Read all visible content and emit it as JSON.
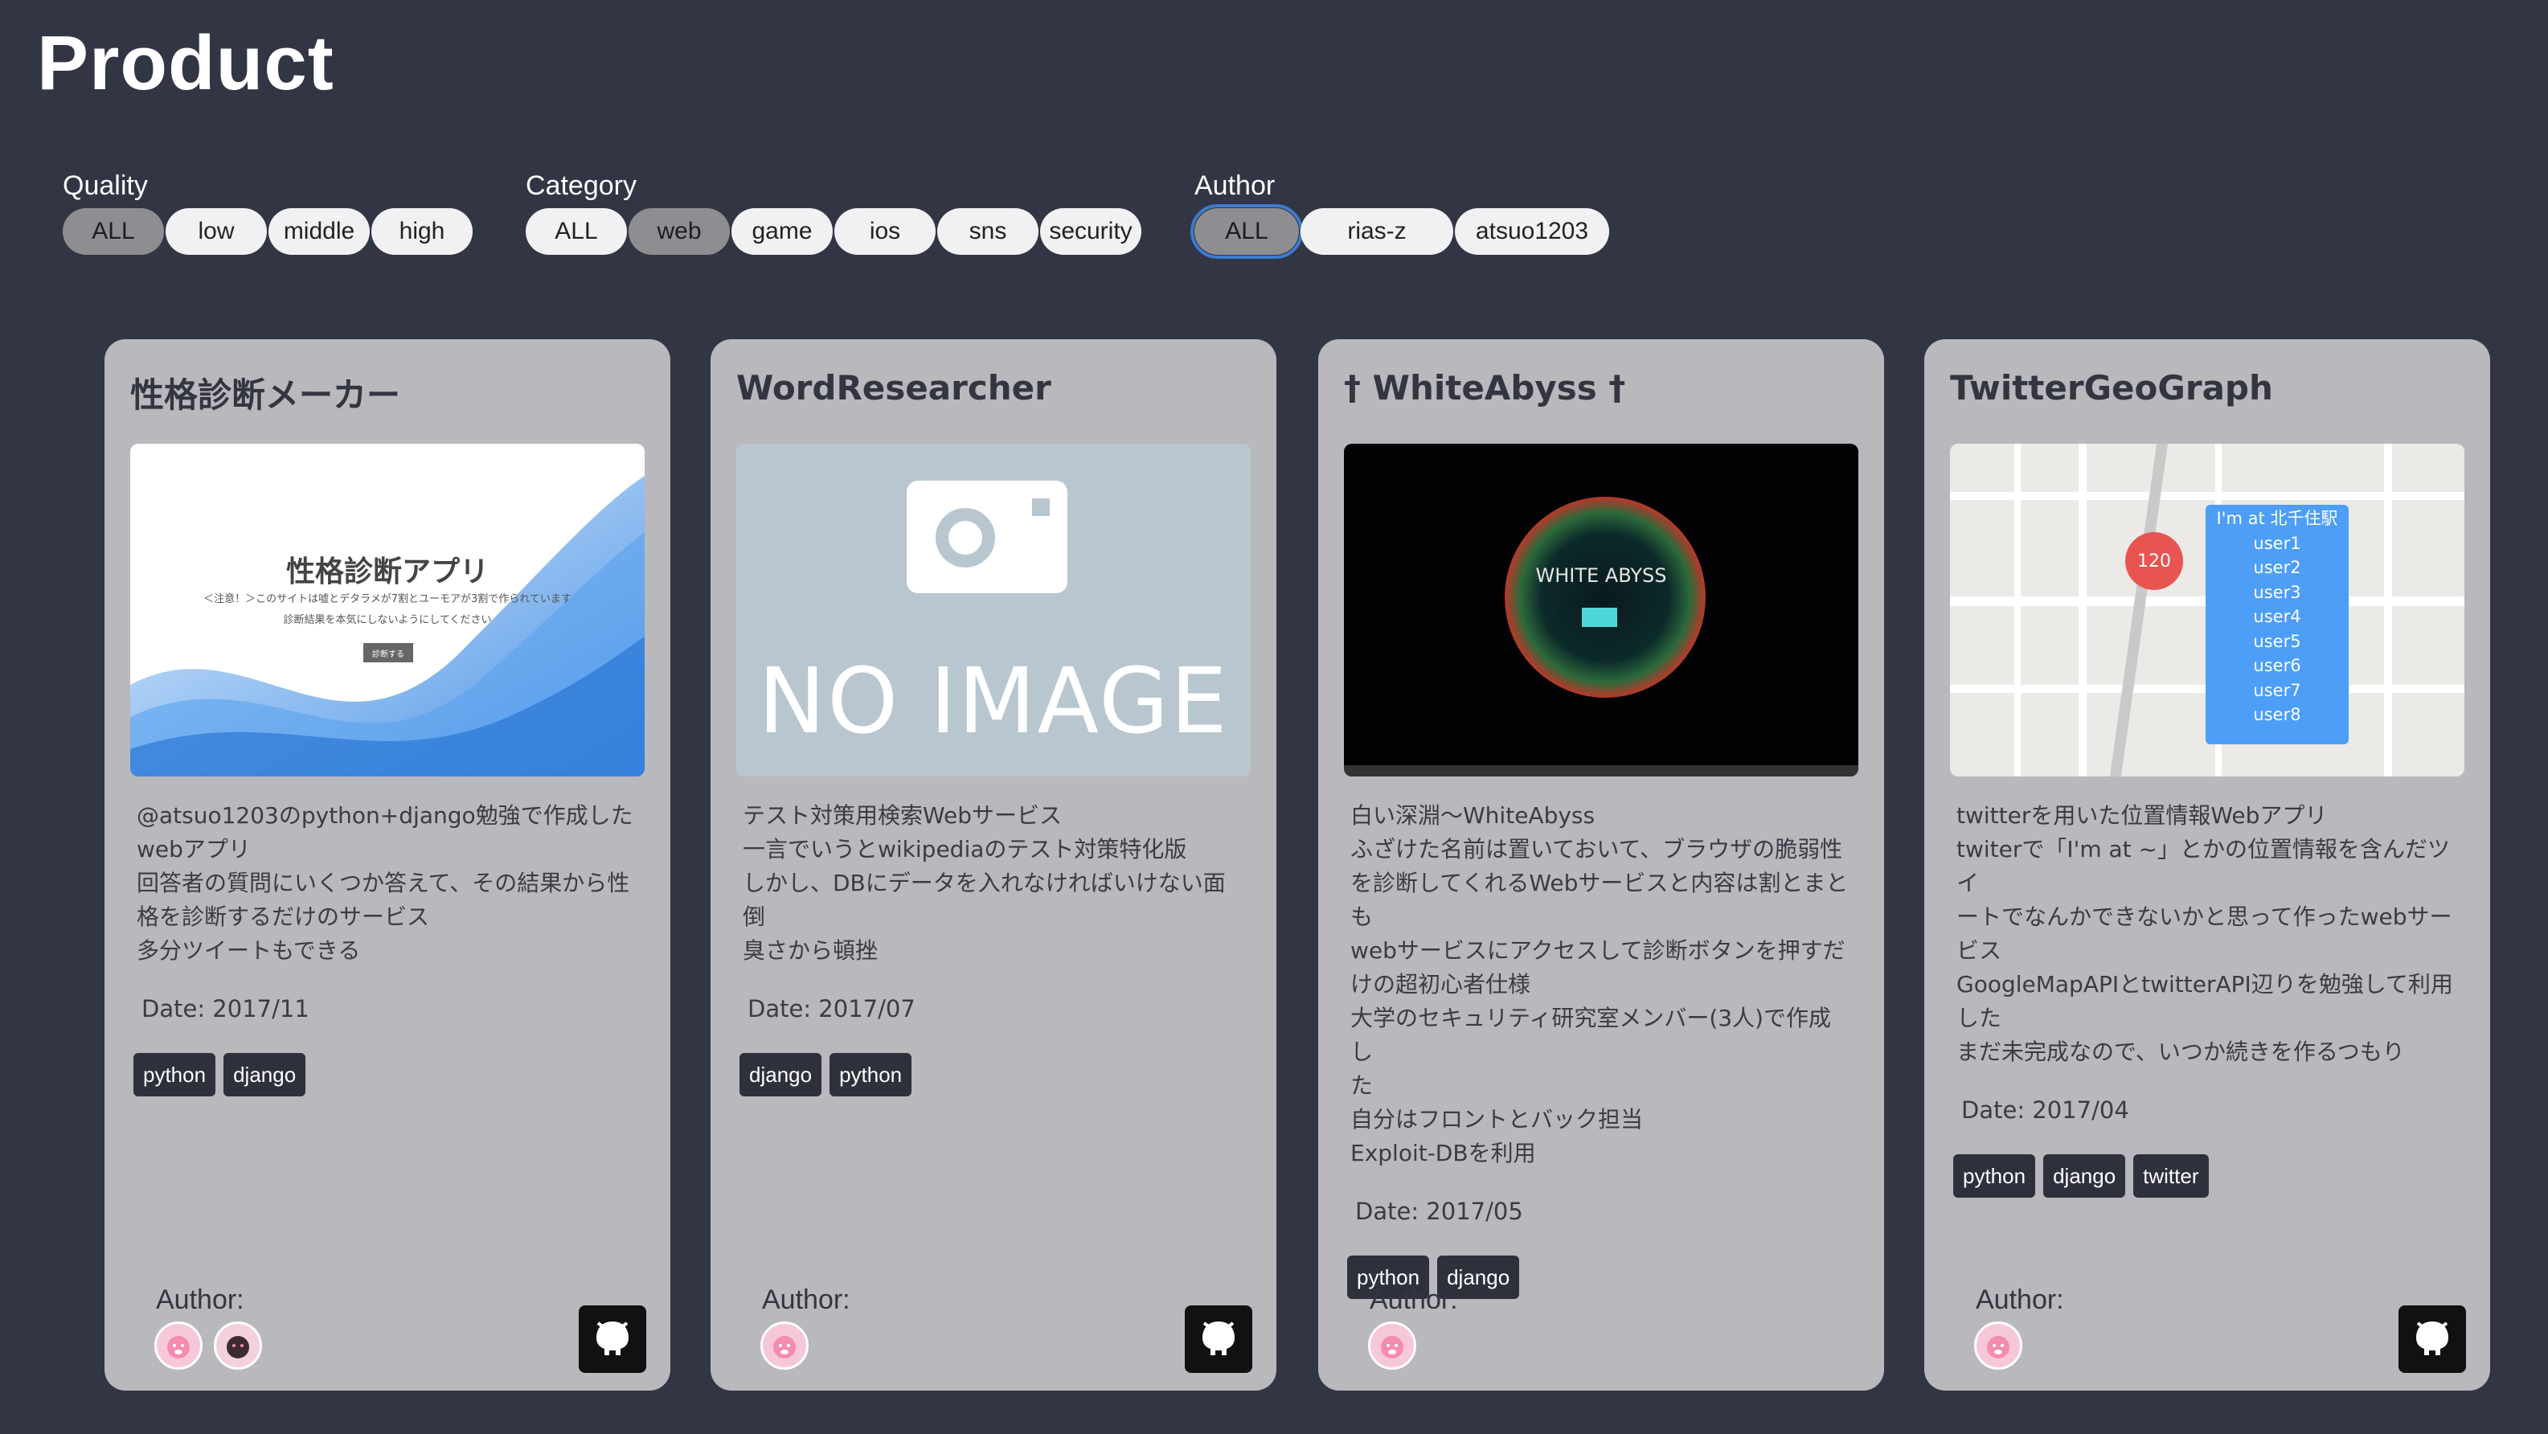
{
  "page": {
    "title": "Product"
  },
  "filters": {
    "quality": {
      "label": "Quality",
      "options": [
        "ALL",
        "low",
        "middle",
        "high"
      ],
      "selected": "ALL"
    },
    "category": {
      "label": "Category",
      "options": [
        "ALL",
        "web",
        "game",
        "ios",
        "sns",
        "security"
      ],
      "selected": "web"
    },
    "author": {
      "label": "Author",
      "options": [
        "ALL",
        "rias-z",
        "atsuo1203"
      ],
      "selected": "ALL"
    }
  },
  "cards": [
    {
      "title": "性格診断メーカー",
      "image": {
        "type": "wave",
        "title": "性格診断アプリ",
        "line1": "＜注意！＞このサイトは嘘とデタラメが7割とユーモアが3割で作られています",
        "line2": "診断結果を本気にしないようにしてください",
        "button": "診断する"
      },
      "description": [
        "@atsuo1203のpython+django勉強で作成した",
        "webアプリ",
        "回答者の質問にいくつか答えて、その結果から性",
        "格を診断するだけのサービス",
        "多分ツイートもできる"
      ],
      "date": "Date: 2017/11",
      "tags": [
        "python",
        "django"
      ],
      "author_label": "Author:",
      "authors": [
        "avatar-pink",
        "avatar-dark"
      ]
    },
    {
      "title": "WordResearcher",
      "image": {
        "type": "noimage",
        "text": "NO IMAGE"
      },
      "description": [
        "テスト対策用検索Webサービス",
        "一言でいうとwikipediaのテスト対策特化版",
        "しかし、DBにデータを入れなければいけない面倒",
        "臭さから頓挫"
      ],
      "date": "Date: 2017/07",
      "tags": [
        "django",
        "python"
      ],
      "author_label": "Author:",
      "authors": [
        "avatar-pink"
      ]
    },
    {
      "title": "† WhiteAbyss †",
      "image": {
        "type": "abyss",
        "text": "WHITE ABYSS"
      },
      "description": [
        "白い深淵〜WhiteAbyss",
        "ふざけた名前は置いておいて、ブラウザの脆弱性",
        "を診断してくれるWebサービスと内容は割とまと",
        "も",
        "webサービスにアクセスして診断ボタンを押すだ",
        "けの超初心者仕様",
        "大学のセキュリティ研究室メンバー(3人)で作成し",
        "た",
        "自分はフロントとバック担当",
        "Exploit-DBを利用"
      ],
      "date": "Date: 2017/05",
      "tags": [
        "python",
        "django"
      ],
      "author_label": "Author:",
      "authors": [
        "avatar-pink"
      ]
    },
    {
      "title": "TwitterGeoGraph",
      "image": {
        "type": "map",
        "marker": "120",
        "popup": [
          "I'm at 北千住駅",
          "user1",
          "user2",
          "user3",
          "user4",
          "user5",
          "user6",
          "user7",
          "user8"
        ]
      },
      "description": [
        "twitterを用いた位置情報Webアプリ",
        "twiterで「I'm at ~」とかの位置情報を含んだツイ",
        "ートでなんかできないかと思って作ったwebサー",
        "ビス",
        "GoogleMapAPIとtwitterAPI辺りを勉強して利用",
        "した",
        "まだ未完成なので、いつか続きを作るつもり"
      ],
      "date": "Date: 2017/04",
      "tags": [
        "python",
        "django",
        "twitter"
      ],
      "author_label": "Author:",
      "authors": [
        "avatar-pink"
      ]
    }
  ],
  "colors": {
    "background": "#323544",
    "card": "#b8b8bd",
    "pill": "#f1f1f3",
    "pill_active": "#8e8e92",
    "tag": "#2e303c",
    "focus": "#3d7bd0"
  }
}
